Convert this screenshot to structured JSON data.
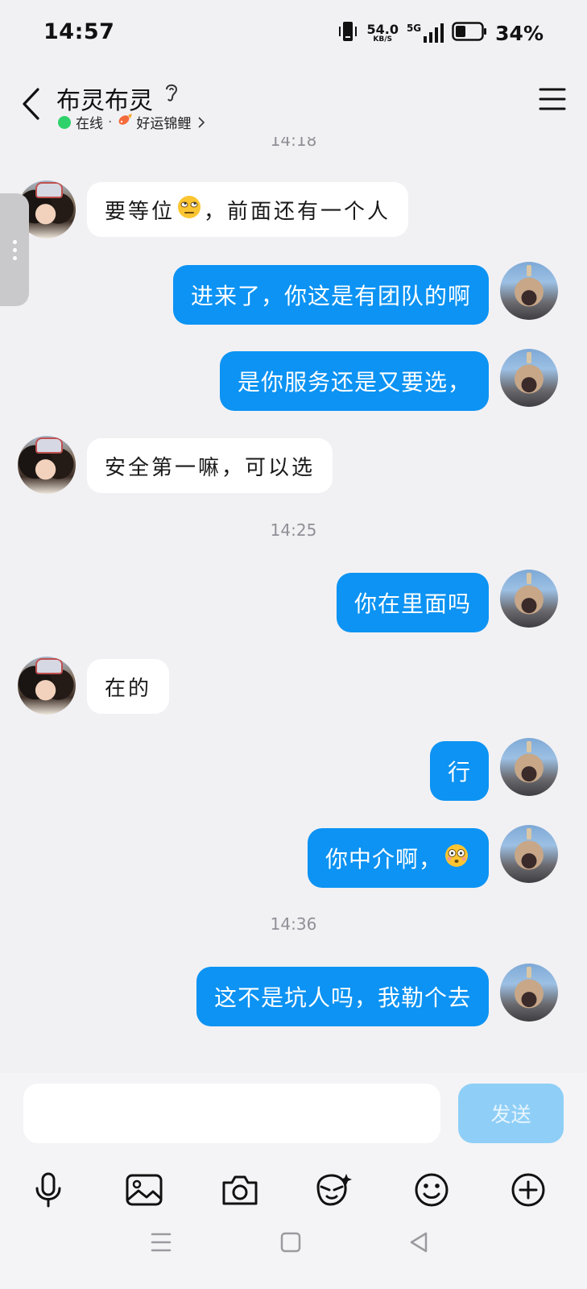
{
  "status_bar": {
    "time": "14:57",
    "net_speed": "54.0",
    "net_unit": "KB/S",
    "network": "5G",
    "battery": "34%"
  },
  "header": {
    "name": "布灵布灵",
    "online": "在线",
    "separator": "·",
    "tag": "好运锦鲤"
  },
  "chat": {
    "partial_timestamp": "14:18",
    "m1": "要等位",
    "m1b": "，前面还有一个人",
    "m2": "进来了，你这是有团队的啊",
    "m3": "是你服务还是又要选，",
    "m4": "安全第一嘛，可以选",
    "ts2": "14:25",
    "m5": "你在里面吗",
    "m6": "在的",
    "m7": "行",
    "m8": "你中介啊，",
    "ts3": "14:36",
    "m9": "这不是坑人吗，我勒个去"
  },
  "input": {
    "placeholder": "",
    "send": "发送"
  },
  "icons": [
    "back-arrow-icon",
    "ear-icon",
    "carp-icon",
    "menu-icon",
    "microphone-icon",
    "image-icon",
    "camera-icon",
    "sticker-icon",
    "emoji-icon",
    "plus-icon"
  ],
  "colors": {
    "outgoing_bubble": "#0c93f3",
    "send_button": "#8fcff7",
    "online": "#2fd16a"
  }
}
